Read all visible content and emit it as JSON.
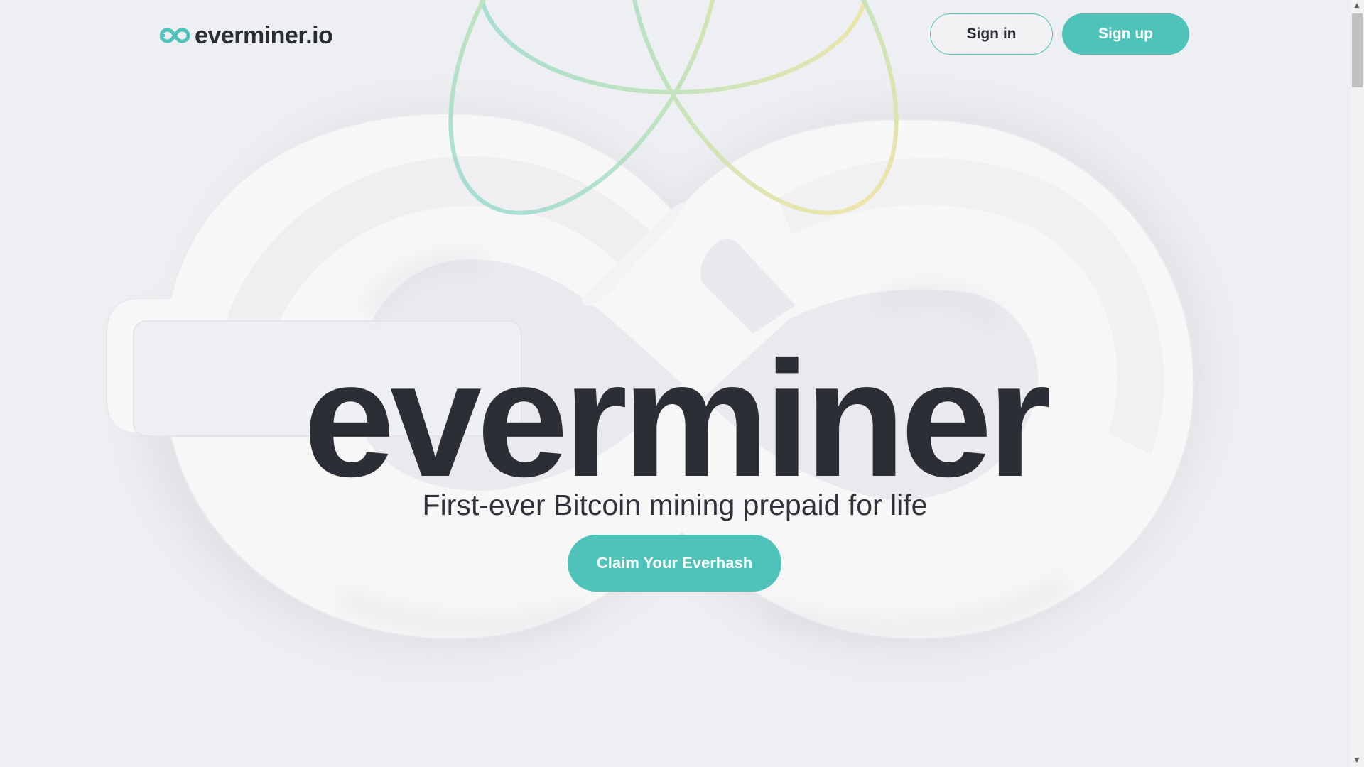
{
  "header": {
    "logo_text": "everminer.io",
    "logo_icon": "infinity-logo-icon",
    "signin_label": "Sign in",
    "signup_label": "Sign up"
  },
  "hero": {
    "title": "everminer",
    "subtitle": "First-ever Bitcoin mining prepaid for life",
    "cta_label": "Claim Your Everhash"
  },
  "colors": {
    "accent": "#4fc3b9",
    "text_dark": "#2b2e35",
    "background": "#eeeff2",
    "orbit_green": "#a9dfc6",
    "orbit_yellow": "#e7e3a0"
  },
  "scrollbar": {
    "up_icon": "scroll-up-arrow-icon",
    "down_icon": "scroll-down-arrow-icon"
  }
}
